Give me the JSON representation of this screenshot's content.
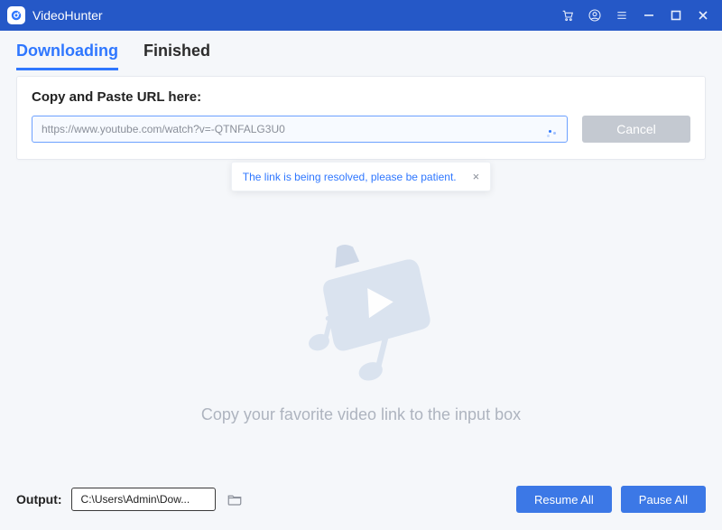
{
  "titlebar": {
    "app_name": "VideoHunter"
  },
  "tabs": {
    "downloading": "Downloading",
    "finished": "Finished"
  },
  "url_panel": {
    "label": "Copy and Paste URL here:",
    "value": "https://www.youtube.com/watch?v=-QTNFALG3U0",
    "cancel": "Cancel"
  },
  "toast": {
    "text": "The link is being resolved, please be patient."
  },
  "empty": {
    "hint": "Copy your favorite video link to the input box"
  },
  "footer": {
    "output_label": "Output:",
    "output_path": "C:\\Users\\Admin\\Dow...",
    "resume": "Resume All",
    "pause": "Pause All"
  }
}
